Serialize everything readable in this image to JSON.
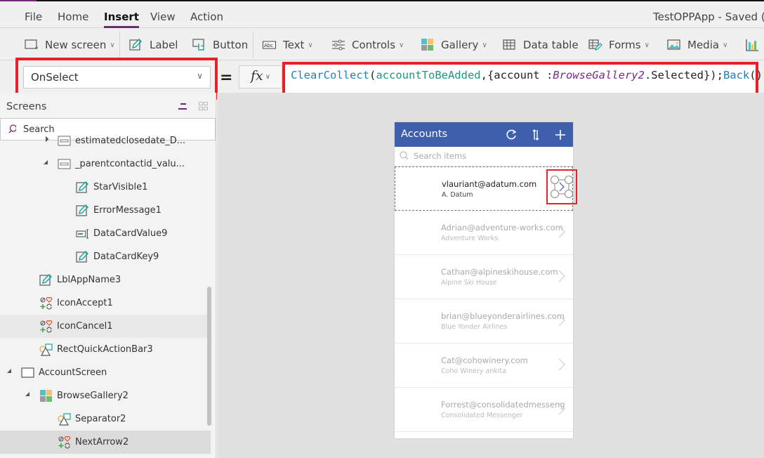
{
  "window": {
    "app_title": "TestOPPApp - Saved (U"
  },
  "menu": {
    "items": [
      {
        "label": "File",
        "active": false
      },
      {
        "label": "Home",
        "active": false
      },
      {
        "label": "Insert",
        "active": true
      },
      {
        "label": "View",
        "active": false
      },
      {
        "label": "Action",
        "active": false
      }
    ]
  },
  "ribbon": {
    "new_screen": "New screen",
    "label": "Label",
    "button": "Button",
    "text": "Text",
    "controls": "Controls",
    "gallery": "Gallery",
    "data_table": "Data table",
    "forms": "Forms",
    "media": "Media"
  },
  "formula_bar": {
    "property": "OnSelect",
    "equals": "=",
    "fx_label": "fx",
    "formula_tokens": [
      {
        "text": "ClearCollect",
        "kind": "fn"
      },
      {
        "text": "(",
        "kind": "plain"
      },
      {
        "text": "accountToBeAdded",
        "kind": "var"
      },
      {
        "text": ",{account :",
        "kind": "plain"
      },
      {
        "text": "BrowseGallery2",
        "kind": "ctl"
      },
      {
        "text": ".Selected});",
        "kind": "plain"
      },
      {
        "text": "Back",
        "kind": "fn"
      },
      {
        "text": "()",
        "kind": "plain"
      }
    ]
  },
  "left_panel": {
    "title": "Screens",
    "search_placeholder": "Search",
    "tree": [
      {
        "label": "estimatedclosedate_D...",
        "icon": "card-icon",
        "indent": 2,
        "expander": "collapsed"
      },
      {
        "label": "_parentcontactid_valu...",
        "icon": "card-icon",
        "indent": 2,
        "expander": "expanded"
      },
      {
        "label": "StarVisible1",
        "icon": "label-icon",
        "indent": 3
      },
      {
        "label": "ErrorMessage1",
        "icon": "label-icon",
        "indent": 3
      },
      {
        "label": "DataCardValue9",
        "icon": "text-input-icon",
        "indent": 3
      },
      {
        "label": "DataCardKey9",
        "icon": "label-icon",
        "indent": 3
      },
      {
        "label": "LblAppName3",
        "icon": "label-icon",
        "indent": 1
      },
      {
        "label": "IconAccept1",
        "icon": "icons-icon",
        "indent": 1
      },
      {
        "label": "IconCancel1",
        "icon": "icons-icon",
        "indent": 1,
        "state": "hover"
      },
      {
        "label": "RectQuickActionBar3",
        "icon": "shapes-icon",
        "indent": 1
      },
      {
        "label": "AccountScreen",
        "icon": "screen-icon",
        "indent": 0,
        "expander": "expanded"
      },
      {
        "label": "BrowseGallery2",
        "icon": "gallery-icon",
        "indent": 1,
        "expander": "expanded"
      },
      {
        "label": "Separator2",
        "icon": "shapes-icon",
        "indent": 2
      },
      {
        "label": "NextArrow2",
        "icon": "icons-icon",
        "indent": 2,
        "state": "selected"
      }
    ]
  },
  "phone": {
    "header_title": "Accounts",
    "header_color": "#3e5fac",
    "search_placeholder": "Search items",
    "rows": [
      {
        "email": "vlauriant@adatum.com",
        "company": "A. Datum",
        "active": true
      },
      {
        "email": "Adrian@adventure-works.com",
        "company": "Adventure Works"
      },
      {
        "email": "Cathan@alpineskihouse.com",
        "company": "Alpine Ski House"
      },
      {
        "email": "brian@blueyonderairlines.com",
        "company": "Blue Yonder Airlines"
      },
      {
        "email": "Cat@cohowinery.com",
        "company": "Coho Winery ankita"
      },
      {
        "email": "Forrest@consolidatedmesseng",
        "company": "Consolidated Messenger"
      }
    ]
  },
  "colors": {
    "accent": "#742774",
    "highlight_box": "#e8202a",
    "formula_function": "#1f7fbf",
    "formula_variable": "#1a9a83",
    "formula_control": "#7a2c8e"
  }
}
